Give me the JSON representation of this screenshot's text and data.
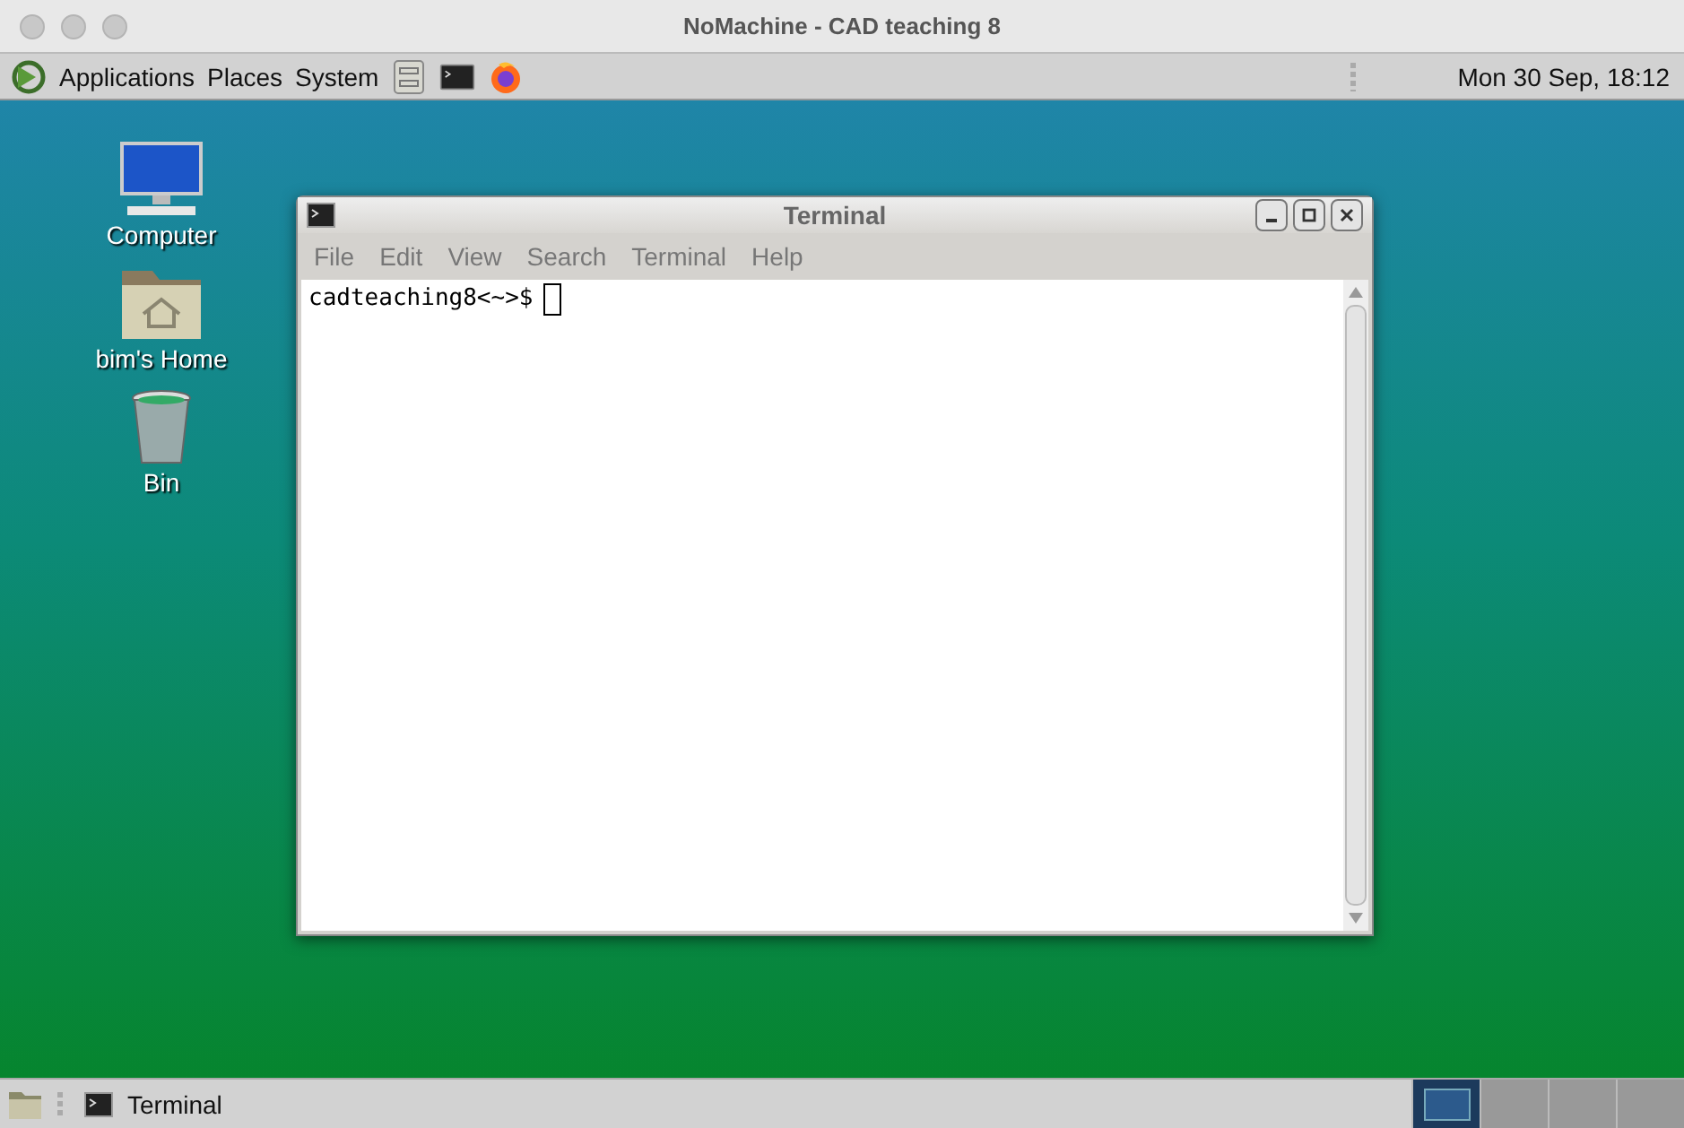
{
  "window": {
    "title": "NoMachine - CAD teaching 8"
  },
  "top_panel": {
    "menus": [
      "Applications",
      "Places",
      "System"
    ],
    "clock": "Mon 30 Sep, 18:12"
  },
  "desktop_icons": [
    {
      "kind": "computer",
      "label": "Computer"
    },
    {
      "kind": "home",
      "label": "bim's Home"
    },
    {
      "kind": "bin",
      "label": "Bin"
    }
  ],
  "terminal": {
    "title": "Terminal",
    "menus": [
      "File",
      "Edit",
      "View",
      "Search",
      "Terminal",
      "Help"
    ],
    "prompt": "cadteaching8<~>$"
  },
  "bottom_panel": {
    "tasks": [
      {
        "label": "Terminal"
      }
    ],
    "workspaces": [
      {
        "selected": true
      },
      {
        "selected": false
      },
      {
        "selected": false
      },
      {
        "selected": false
      }
    ]
  }
}
